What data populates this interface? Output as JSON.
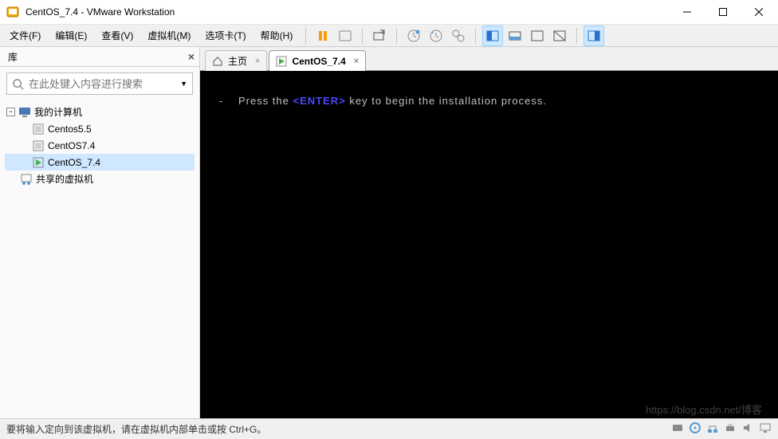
{
  "window": {
    "title": "CentOS_7.4 - VMware Workstation"
  },
  "menu": {
    "file": "文件(F)",
    "edit": "编辑(E)",
    "view": "查看(V)",
    "vm": "虚拟机(M)",
    "tabs": "选项卡(T)",
    "help": "帮助(H)"
  },
  "sidebar": {
    "title": "库",
    "search_placeholder": "在此处键入内容进行搜索",
    "root": "我的计算机",
    "shared": "共享的虚拟机",
    "items": [
      {
        "label": "Centos5.5"
      },
      {
        "label": "CentOS7.4"
      },
      {
        "label": "CentOS_7.4"
      }
    ]
  },
  "tabs": {
    "home": "主页",
    "vm": "CentOS_7.4"
  },
  "console": {
    "dash": "-",
    "t1": "Press the",
    "enter": "<ENTER>",
    "t2": "key to begin the installation process."
  },
  "status": {
    "text": "要将输入定向到该虚拟机，请在虚拟机内部单击或按 Ctrl+G。"
  },
  "watermark": "https://blog.csdn.net/博客"
}
